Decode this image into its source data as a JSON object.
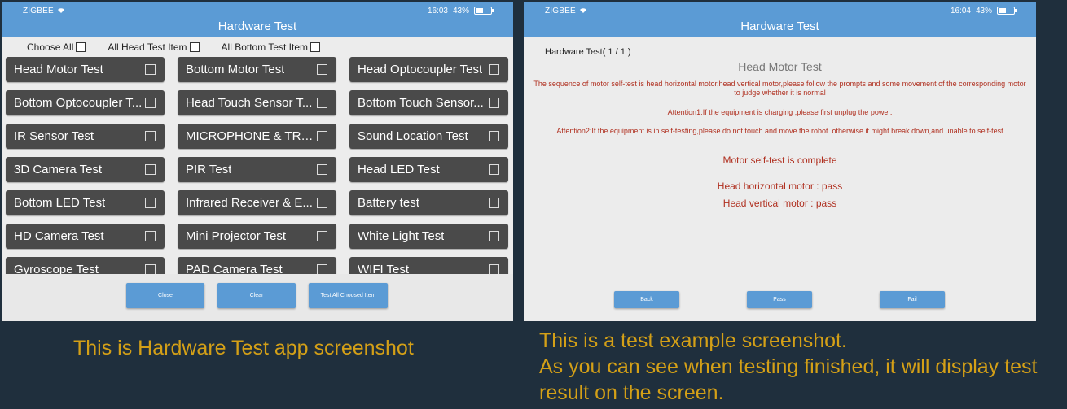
{
  "left_screen": {
    "status": {
      "network": "ZIGBEE",
      "wifi_icon": "wifi-icon",
      "time": "16:03",
      "battery": "43%"
    },
    "title": "Hardware Test",
    "choose": [
      "Choose All",
      "All Head Test Item",
      "All Bottom Test Item"
    ],
    "tests": [
      "Head Motor Test",
      "Bottom Motor Test",
      "Head Optocoupler Test",
      "Bottom Optocoupler T...",
      "Head Touch Sensor T...",
      "Bottom Touch Sensor...",
      "IR Sensor Test",
      "MICROPHONE & TRU...",
      "Sound Location Test",
      "3D Camera Test",
      "PIR Test",
      "Head LED Test",
      "Bottom LED Test",
      "Infrared Receiver & E...",
      "Battery test",
      "HD Camera Test",
      "Mini Projector Test",
      "White Light Test",
      "Gyroscope Test",
      "PAD Camera Test",
      "WIFI Test"
    ],
    "buttons": {
      "close": "Close",
      "clear": "Clear",
      "test_all": "Test All Choosed Item"
    }
  },
  "right_screen": {
    "status": {
      "network": "ZIGBEE",
      "wifi_icon": "wifi-icon",
      "time": "16:04",
      "battery": "43%"
    },
    "title": "Hardware Test",
    "page_label": "Hardware Test( 1 / 1 )",
    "test_name": "Head Motor Test",
    "instructions": "The sequence of motor self-test is head horizontal motor,head vertical motor,please follow the prompts and some movement of the corresponding motor to judge whether it is normal",
    "attention1": "Attention1:If the equipment is charging ,please first unplug the power.",
    "attention2": "Attention2:If the equipment is in self-testing,please do not touch and move the robot .otherwise it might break down,and unable to self-test",
    "complete": "Motor self-test is complete",
    "result1": "Head horizontal motor : pass",
    "result2": "Head vertical motor : pass",
    "buttons": {
      "back": "Back",
      "pass": "Pass",
      "fail": "Fail"
    }
  },
  "captions": {
    "left": "This is Hardware Test app screenshot",
    "right_line1": "This is a test example screenshot.",
    "right_line2": "As you can see when testing finished, it will display test",
    "right_line3": "result on the screen."
  },
  "colors": {
    "background": "#1f2f3d",
    "accent": "#5b9bd5",
    "caption": "#d4a017",
    "result_red": "#b03020"
  }
}
